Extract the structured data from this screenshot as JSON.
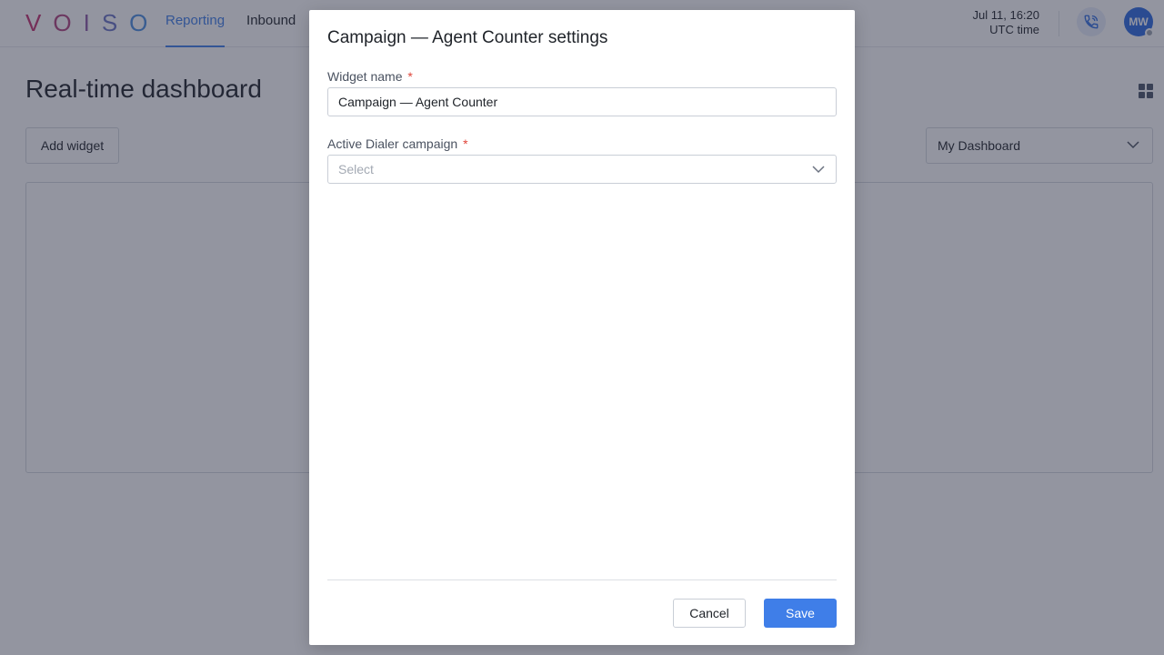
{
  "app": {
    "logo_letters": [
      "V",
      "O",
      "I",
      "S",
      "O"
    ],
    "logo_colors": [
      "#c2306e",
      "#b0447f",
      "#8e5aa6",
      "#6a74c4",
      "#4b8fe0"
    ]
  },
  "nav": {
    "items": [
      {
        "label": "Reporting",
        "active": true
      },
      {
        "label": "Inbound",
        "active": false
      }
    ]
  },
  "header": {
    "date_time": "Jul 11, 16:20",
    "timezone": "UTC time",
    "avatar_initials": "MW",
    "phone_icon": "phone-icon"
  },
  "page": {
    "title": "Real-time dashboard",
    "add_widget_label": "Add widget",
    "dashboard_select_value": "My Dashboard",
    "layout_icon": "grid-icon"
  },
  "modal": {
    "title": "Campaign — Agent Counter settings",
    "widget_name_label": "Widget name",
    "widget_name_value": "Campaign — Agent Counter",
    "campaign_label": "Active Dialer campaign",
    "campaign_placeholder": "Select",
    "required_marker": "*",
    "cancel_label": "Cancel",
    "save_label": "Save"
  },
  "colors": {
    "accent": "#3f7ee8",
    "required": "#e0453a",
    "overlay": "rgba(40, 44, 66, 0.5)",
    "avatar": "#2c6be0"
  }
}
